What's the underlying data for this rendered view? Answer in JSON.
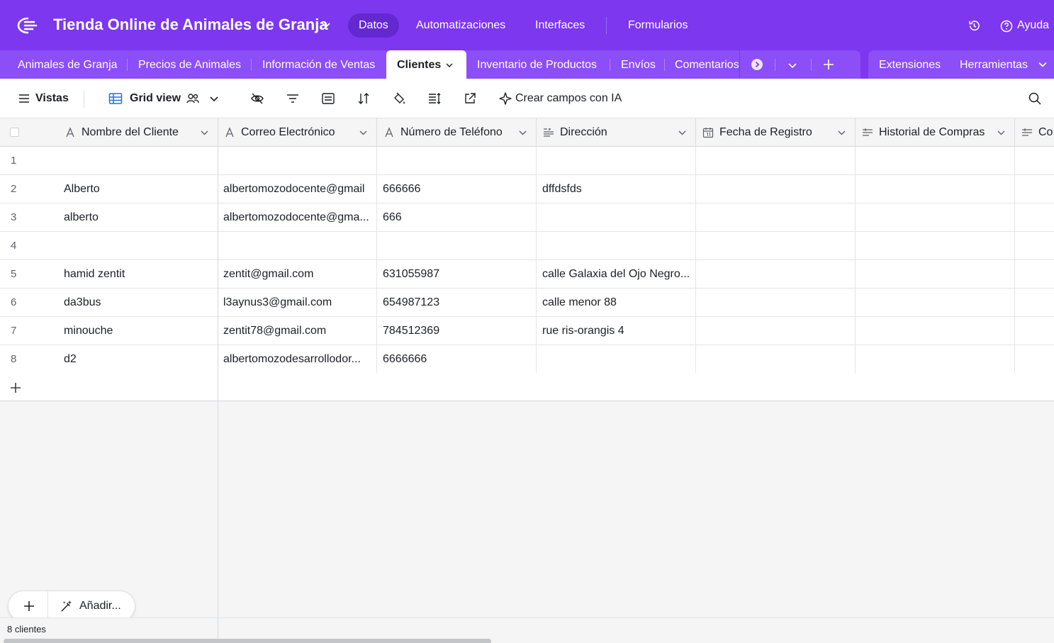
{
  "app": {
    "base_title": "Tienda Online de Animales de Granja",
    "nav": [
      "Datos",
      "Automatizaciones",
      "Interfaces",
      "Formularios"
    ],
    "active_nav": "Datos",
    "help_label": "Ayuda",
    "brand_color": "#7c37ef"
  },
  "tables": {
    "tabs": [
      "Animales de Granja",
      "Precios de Animales",
      "Información de Ventas",
      "Clientes",
      "Inventario de Productos",
      "Envíos",
      "Comentarios"
    ],
    "active": "Clientes",
    "right_tools": [
      "Extensiones",
      "Herramientas"
    ]
  },
  "viewbar": {
    "views_label": "Vistas",
    "view_name": "Grid view",
    "ai_label": "Crear campos con IA"
  },
  "grid": {
    "columns": [
      {
        "label": "Nombre del Cliente",
        "icon": "text-icon"
      },
      {
        "label": "Correo Electrónico",
        "icon": "text-icon"
      },
      {
        "label": "Número de Teléfono",
        "icon": "text-icon"
      },
      {
        "label": "Dirección",
        "icon": "long-text-icon"
      },
      {
        "label": "Fecha de Registro",
        "icon": "calendar-icon"
      },
      {
        "label": "Historial de Compras",
        "icon": "long-text-icon"
      },
      {
        "label": "Co",
        "icon": "long-text-icon"
      }
    ],
    "rows": [
      {
        "num": "1",
        "name": "",
        "email": "",
        "phone": "",
        "address": ""
      },
      {
        "num": "2",
        "name": "Alberto",
        "email": "albertomozodocente@gmail",
        "phone": "666666",
        "address": "dffdsfds"
      },
      {
        "num": "3",
        "name": "alberto",
        "email": "albertomozodocente@gma...",
        "phone": "666",
        "address": ""
      },
      {
        "num": "4",
        "name": "",
        "email": "",
        "phone": "",
        "address": ""
      },
      {
        "num": "5",
        "name": "hamid zentit",
        "email": "zentit@gmail.com",
        "phone": "631055987",
        "address": "calle Galaxia del Ojo Negro..."
      },
      {
        "num": "6",
        "name": "da3bus",
        "email": "l3aynus3@gmail.com",
        "phone": "654987123",
        "address": "calle menor 88"
      },
      {
        "num": "7",
        "name": "minouche",
        "email": "zentit78@gmail.com",
        "phone": "784512369",
        "address": "rue ris-orangis 4"
      },
      {
        "num": "8",
        "name": "d2",
        "email": "albertomozodesarrollodor...",
        "phone": "6666666",
        "address": ""
      }
    ]
  },
  "add_pill": {
    "label": "Añadir..."
  },
  "footer": {
    "count": "8 clientes"
  }
}
